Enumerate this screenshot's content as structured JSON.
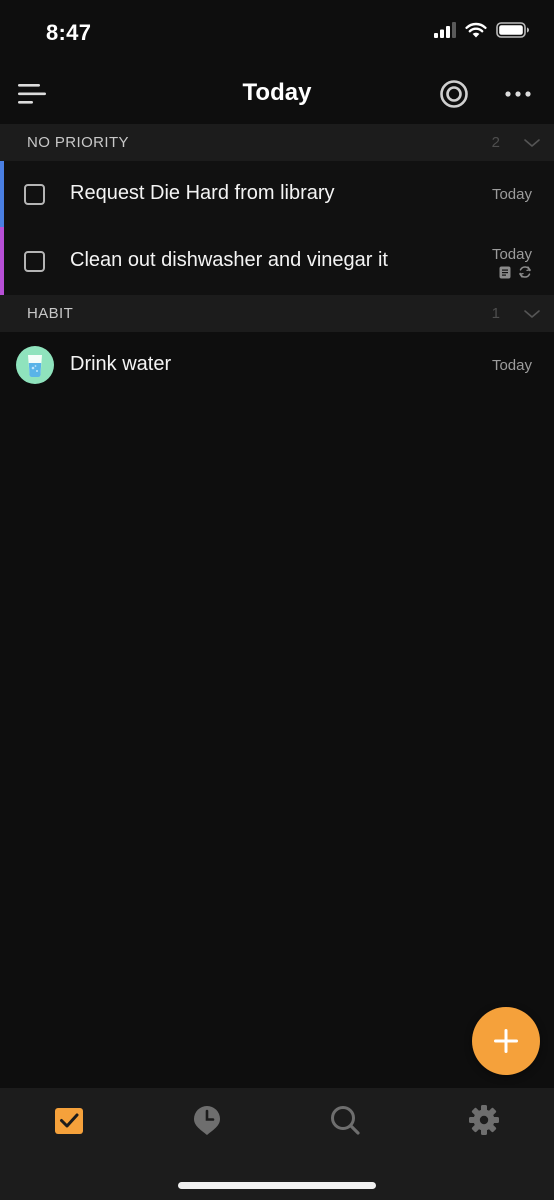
{
  "status_bar": {
    "time": "8:47",
    "icons": [
      "cellular-signal-icon",
      "wifi-icon",
      "battery-icon"
    ]
  },
  "header": {
    "title": "Today",
    "left_icon": "menu-icon",
    "right_icons": [
      "focus-icon",
      "more-icon"
    ]
  },
  "sections": [
    {
      "title": "NO PRIORITY",
      "count": "2",
      "collapsed": false,
      "tasks": [
        {
          "title": "Request Die Hard from library",
          "date": "Today",
          "checked": false,
          "list_color": "#4a7fe3",
          "has_note": false,
          "repeats": false
        },
        {
          "title": "Clean out dishwasher and vinegar it",
          "date": "Today",
          "checked": false,
          "list_color": "#b74fd6",
          "has_note": true,
          "repeats": true
        }
      ]
    },
    {
      "title": "HABIT",
      "count": "1",
      "collapsed": false,
      "habits": [
        {
          "title": "Drink water",
          "date": "Today",
          "icon": "water-glass-icon",
          "icon_color": "#8fe3bd"
        }
      ]
    }
  ],
  "fab": {
    "icon": "plus-icon",
    "color": "#f5a13b"
  },
  "tab_bar": {
    "tabs": [
      {
        "icon": "task-checkbox-icon",
        "active": true
      },
      {
        "icon": "calendar-pin-icon",
        "active": false
      },
      {
        "icon": "search-icon",
        "active": false
      },
      {
        "icon": "settings-gear-icon",
        "active": false
      }
    ],
    "active_color": "#f5a13b",
    "inactive_color": "#6e6e6e"
  }
}
